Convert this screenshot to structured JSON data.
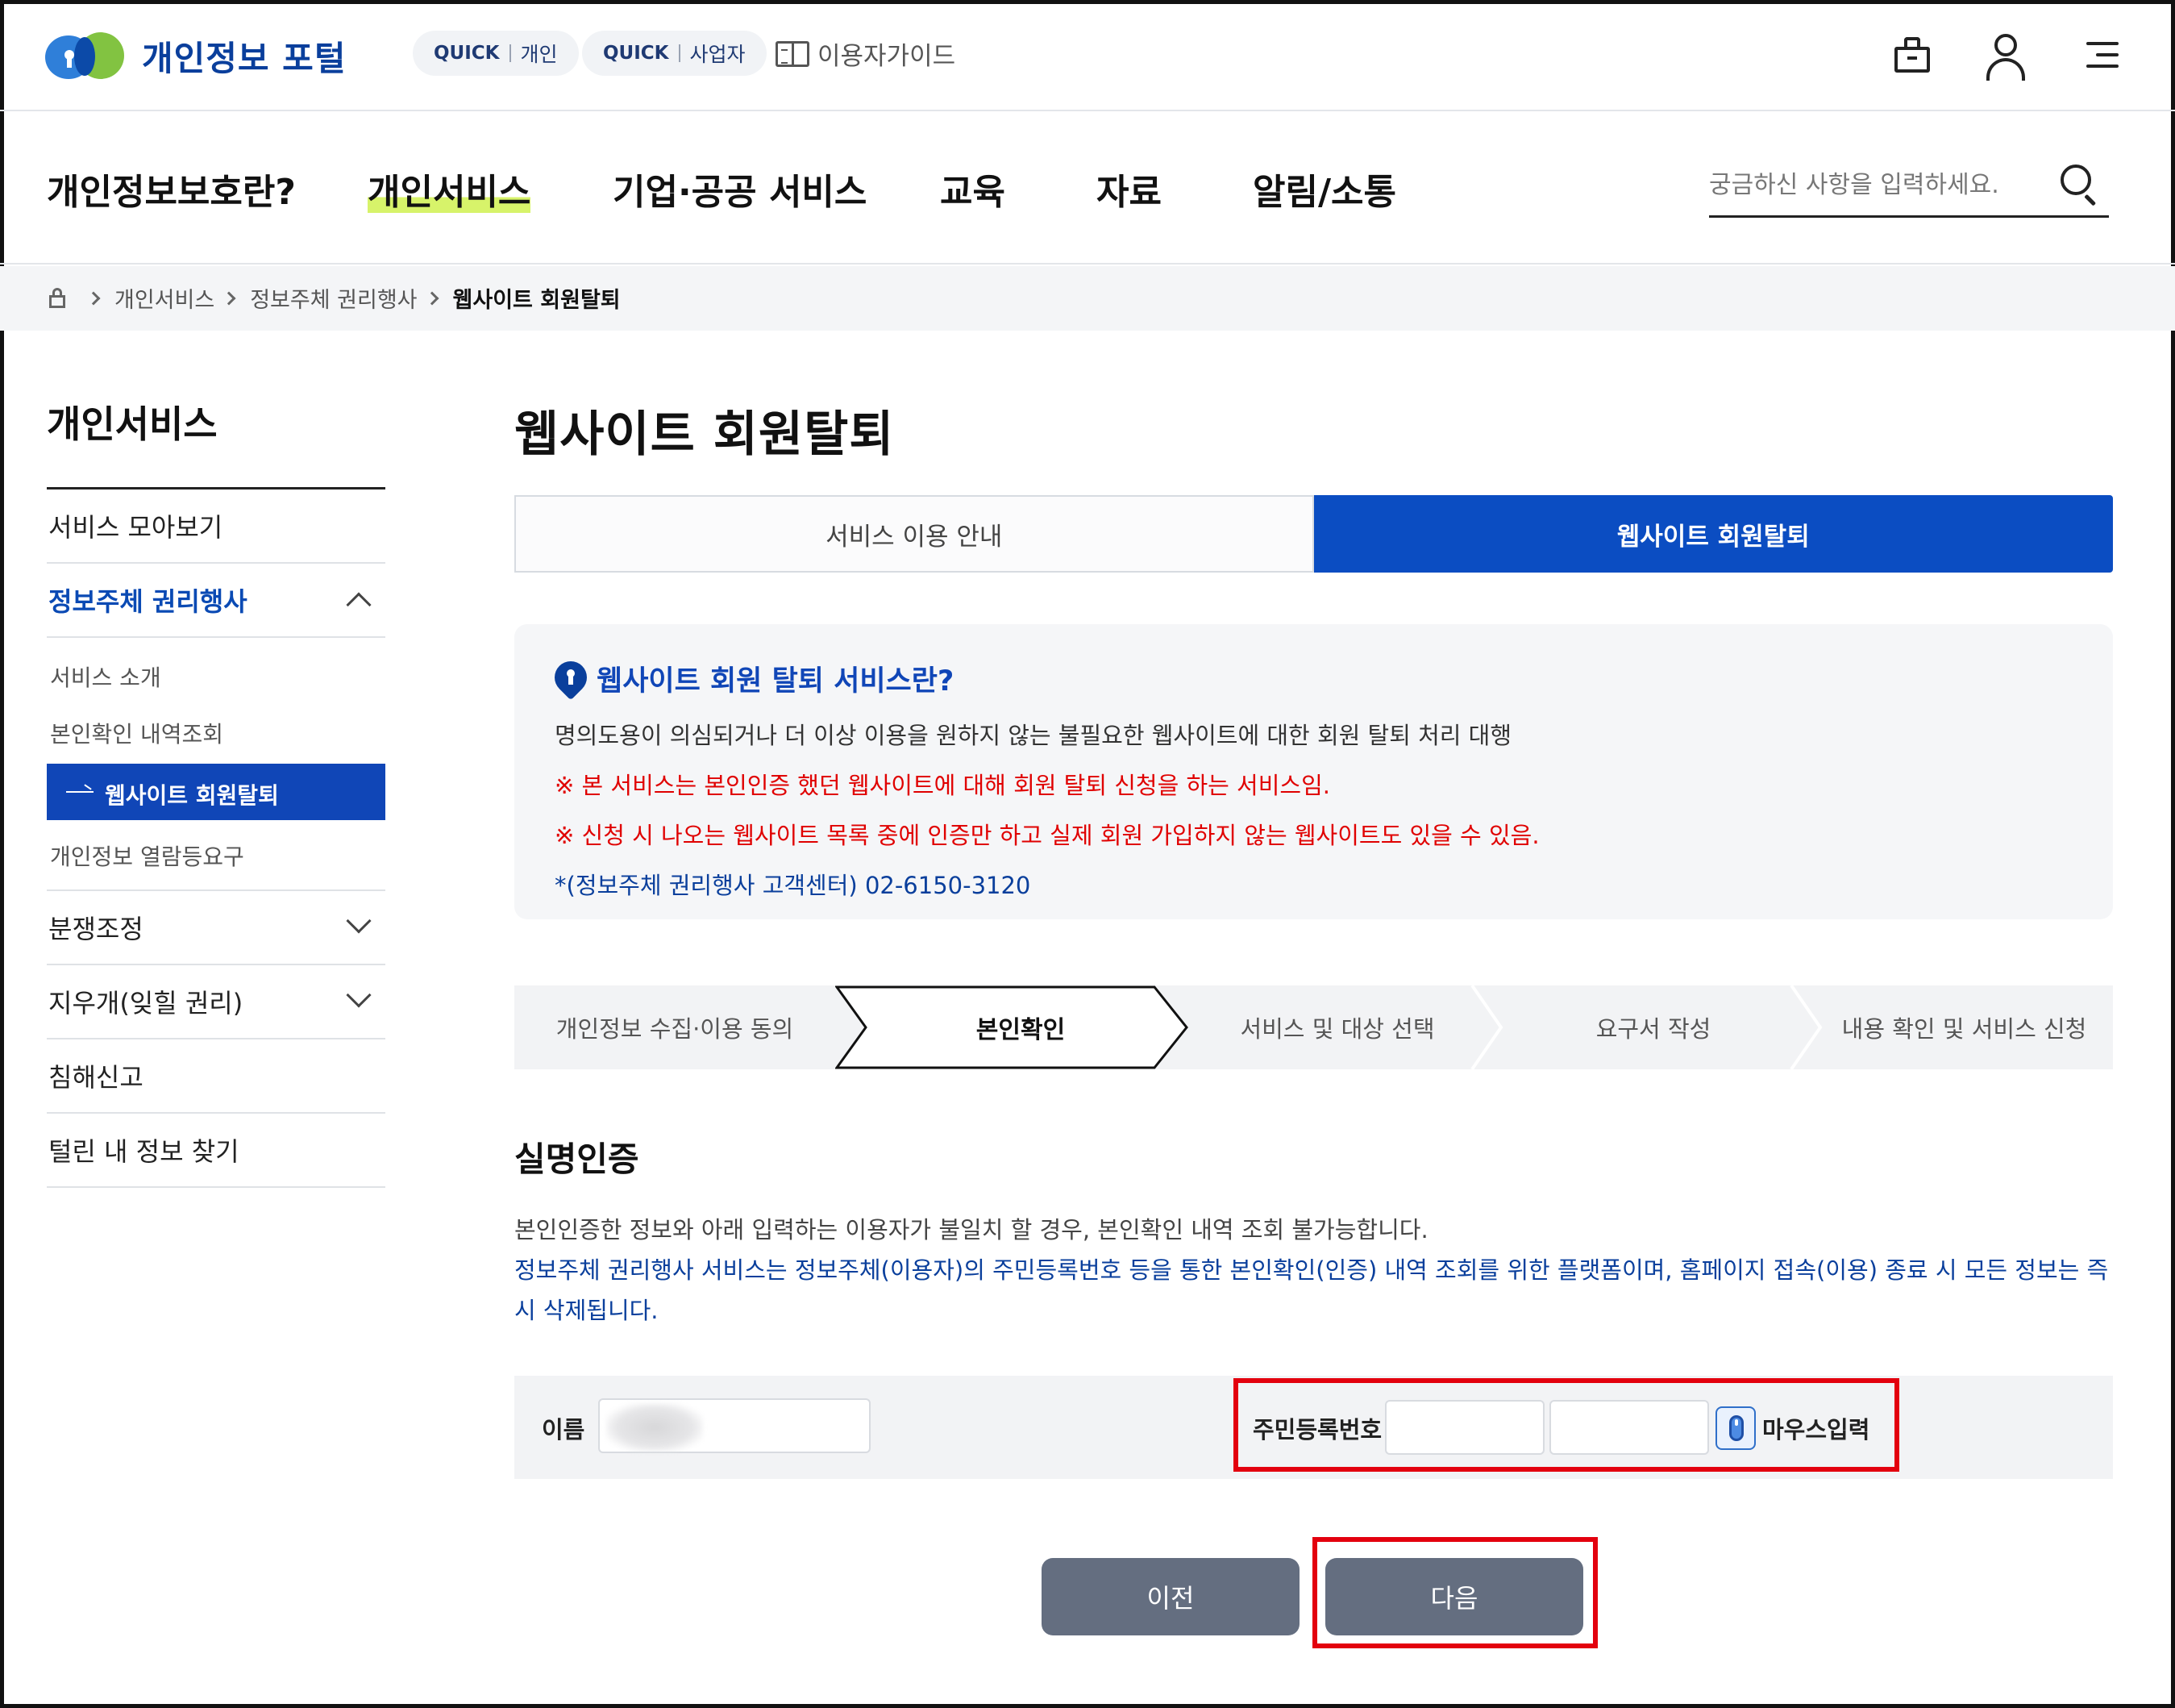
{
  "header": {
    "logo_text": "개인정보 포털",
    "quick_links": [
      {
        "prefix": "QUICK",
        "label": "개인"
      },
      {
        "prefix": "QUICK",
        "label": "사업자"
      }
    ],
    "guide_label": "이용자가이드",
    "icons": [
      "bag-icon",
      "user-icon",
      "menu-icon"
    ]
  },
  "nav": {
    "items": [
      "개인정보보호란?",
      "개인서비스",
      "기업·공공 서비스",
      "교육",
      "자료",
      "알림/소통"
    ],
    "active_index": 1,
    "search_placeholder": "궁금하신 사항을 입력하세요."
  },
  "breadcrumb": [
    "개인서비스",
    "정보주체 권리행사",
    "웹사이트 회원탈퇴"
  ],
  "sidebar": {
    "title": "개인서비스",
    "items": [
      {
        "label": "서비스 모아보기"
      },
      {
        "label": "정보주체 권리행사",
        "open": true,
        "children": [
          "서비스 소개",
          "본인확인 내역조회",
          "웹사이트 회원탈퇴",
          "개인정보 열람등요구"
        ],
        "active_child": 2
      },
      {
        "label": "분쟁조정",
        "expandable": true
      },
      {
        "label": "지우개(잊힐 권리)",
        "expandable": true
      },
      {
        "label": "침해신고"
      },
      {
        "label": "털린 내 정보 찾기"
      }
    ]
  },
  "page": {
    "title": "웹사이트 회원탈퇴",
    "tabs": [
      "서비스 이용 안내",
      "웹사이트 회원탈퇴"
    ],
    "active_tab": 1
  },
  "info": {
    "heading": "웹사이트 회원 탈퇴 서비스란?",
    "description": "명의도용이 의심되거나 더 이상 이용을 원하지 않는 불필요한 웹사이트에 대한 회원 탈퇴 처리 대행",
    "notice1": "※ 본 서비스는 본인인증 했던 웹사이트에 대해 회원 탈퇴 신청을 하는 서비스임.",
    "notice2": "※ 신청 시 나오는 웹사이트 목록 중에 인증만 하고 실제 회원 가입하지 않는 웹사이트도 있을 수 있음.",
    "contact": "*(정보주체 권리행사 고객센터) 02-6150-3120"
  },
  "steps": {
    "items": [
      "개인정보 수집·이용 동의",
      "본인확인",
      "서비스 및 대상 선택",
      "요구서 작성",
      "내용 확인 및 서비스 신청"
    ],
    "active_index": 1
  },
  "realname": {
    "title": "실명인증",
    "desc1": "본인인증한 정보와 아래 입력하는 이용자가 불일치 할 경우, 본인확인 내역 조회 불가능합니다.",
    "desc2": "정보주체 권리행사 서비스는 정보주체(이용자)의 주민등록번호 등을 통한 본인확인(인증) 내역 조회를 위한 플랫폼이며, 홈페이지 접속(이용) 종료 시 모든 정보는 즉시 삭제됩니다.",
    "name_label": "이름",
    "rrn_label": "주민등록번호",
    "mouse_label": "마우스입력"
  },
  "buttons": {
    "prev": "이전",
    "next": "다음"
  },
  "colors": {
    "primary": "#0b4dc2",
    "highlight": "#d7f36a",
    "alert": "#e00000",
    "button": "#646e80",
    "annotation": "#e3000e"
  }
}
